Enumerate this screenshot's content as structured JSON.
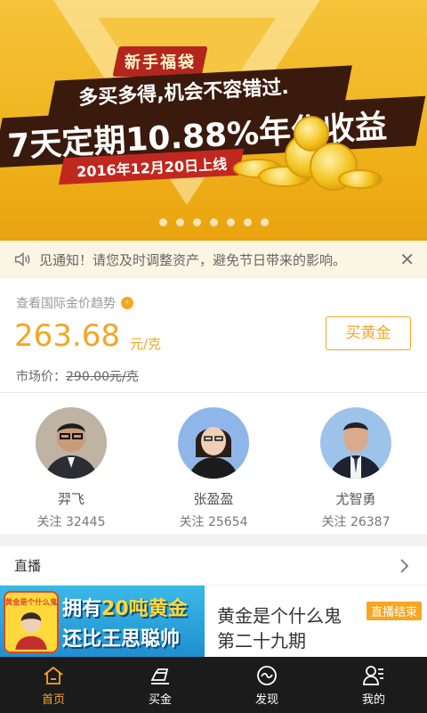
{
  "banner": {
    "tag": "新手福袋",
    "line1": "多买多得,机会不容错过.",
    "line2": "7天定期10.88%年化收益",
    "line3": "2016年12月20日上线",
    "dot_count": 7
  },
  "notice": {
    "text": "见通知！请您及时调整资产，避免节日带来的影响。",
    "close": "✕"
  },
  "gold": {
    "trend_label": "查看国际金价趋势",
    "price": "263.68",
    "unit": "元/克",
    "buy_button": "买黄金",
    "market_label": "市场价：",
    "market_price": "290.00元/克"
  },
  "experts": [
    {
      "name": "羿飞",
      "follow": "关注 32445"
    },
    {
      "name": "张盈盈",
      "follow": "关注 25654"
    },
    {
      "name": "尤智勇",
      "follow": "关注 26387"
    }
  ],
  "live": {
    "header": "直播",
    "item": {
      "thumb_line1a": "拥有",
      "thumb_line1b": "20吨",
      "thumb_line1c": "黄金",
      "thumb_line2": "还比王思聪帅",
      "thumb_badge": "黄金是个什么鬼",
      "title_line1": "黄金是个什么鬼",
      "title_line2": "第二十九期",
      "status": "直播结束"
    }
  },
  "nav": {
    "tabs": [
      {
        "label": "首页",
        "icon": "home-icon"
      },
      {
        "label": "买金",
        "icon": "gold-bar-icon"
      },
      {
        "label": "发现",
        "icon": "discover-icon"
      },
      {
        "label": "我的",
        "icon": "user-icon"
      }
    ]
  },
  "colors": {
    "accent": "#f5a623",
    "nav_bg": "#1b1b1b",
    "notice_bg": "#fbf5e4"
  }
}
